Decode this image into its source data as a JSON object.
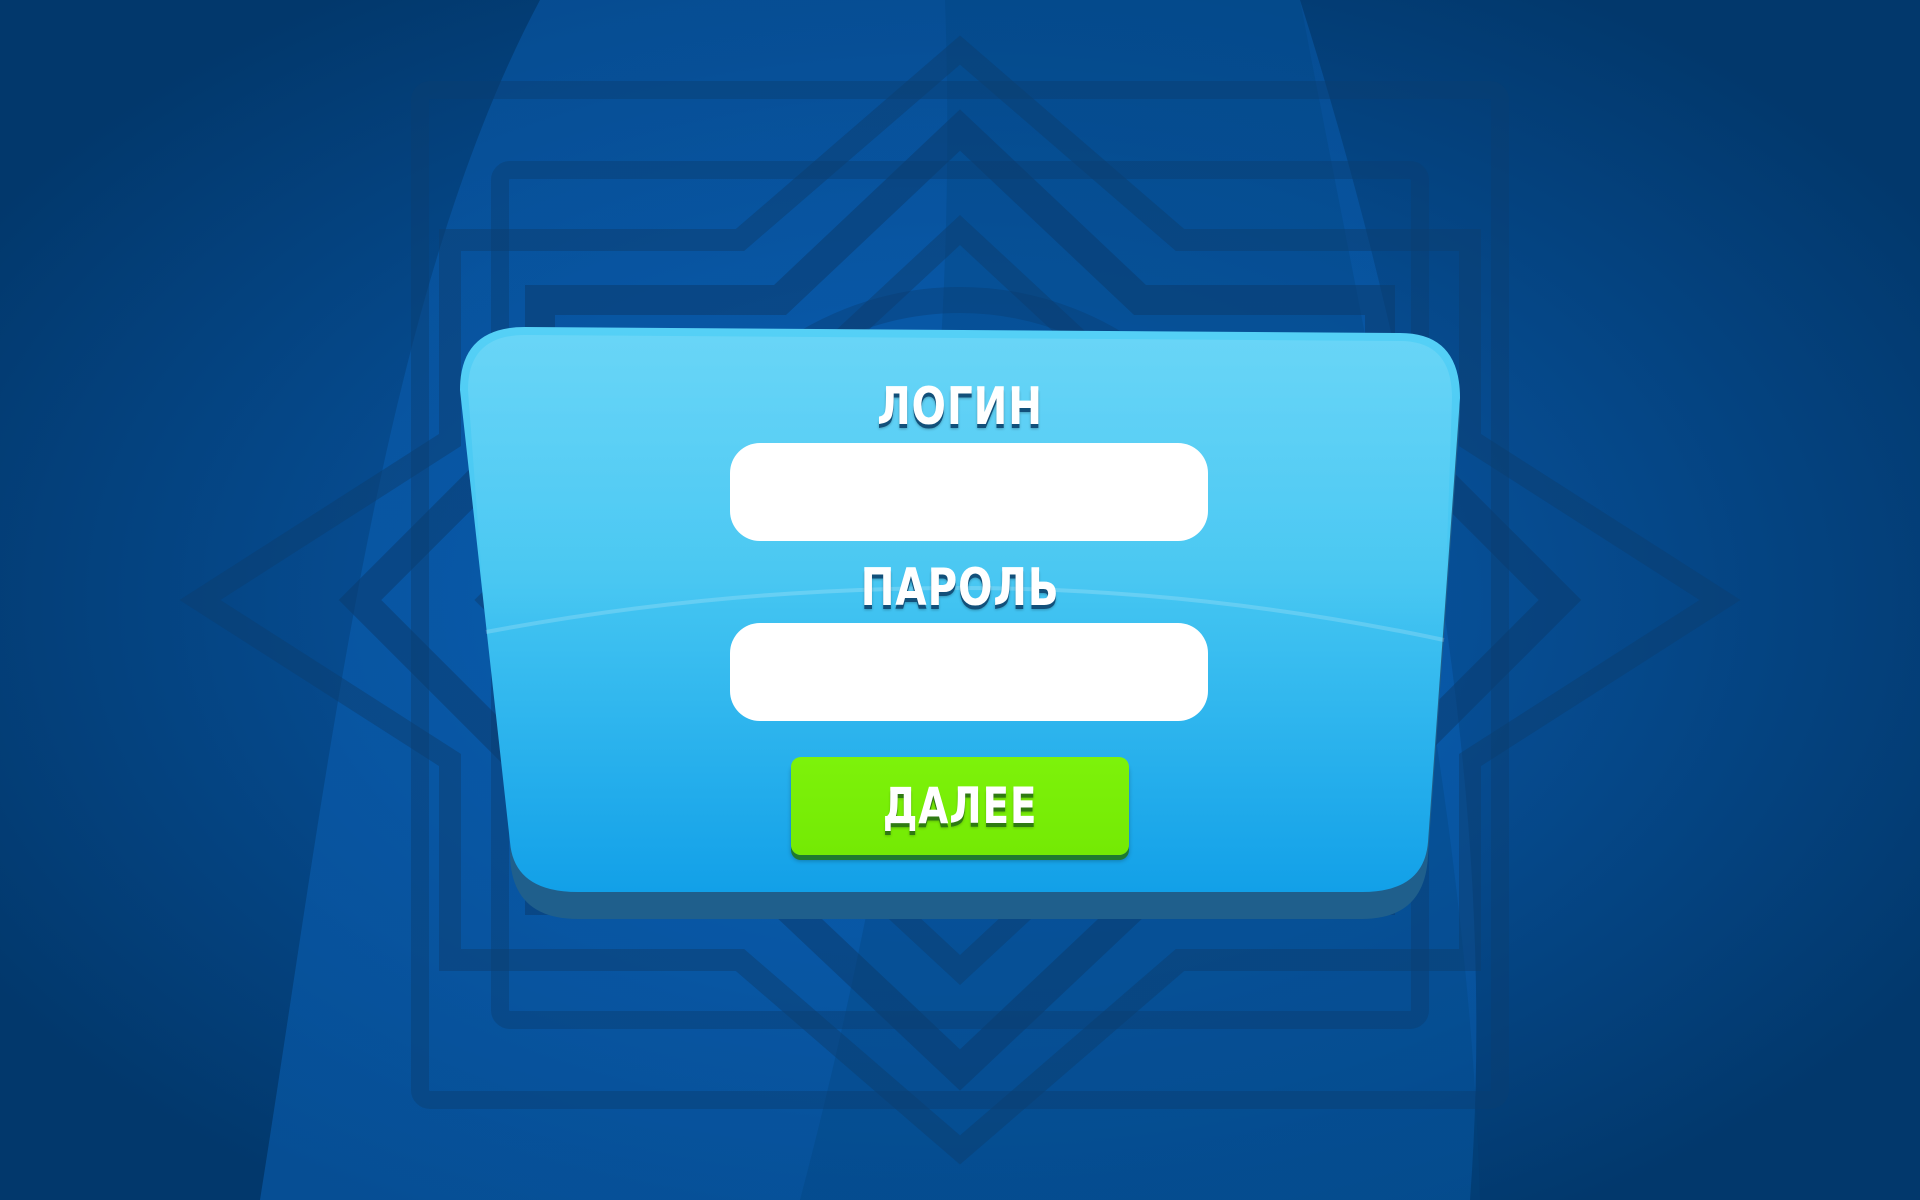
{
  "login_form": {
    "login_label": "ЛОГИН",
    "login_value": "",
    "password_label": "ПАРОЛЬ",
    "password_value": "",
    "next_button_label": "ДАЛЕЕ"
  },
  "colors": {
    "background": "#043f7a",
    "panel_top": "#55d0f6",
    "panel_bottom": "#12a0e8",
    "button": "#78ee06"
  },
  "icons": {
    "background_ornament": "star-ornament"
  }
}
